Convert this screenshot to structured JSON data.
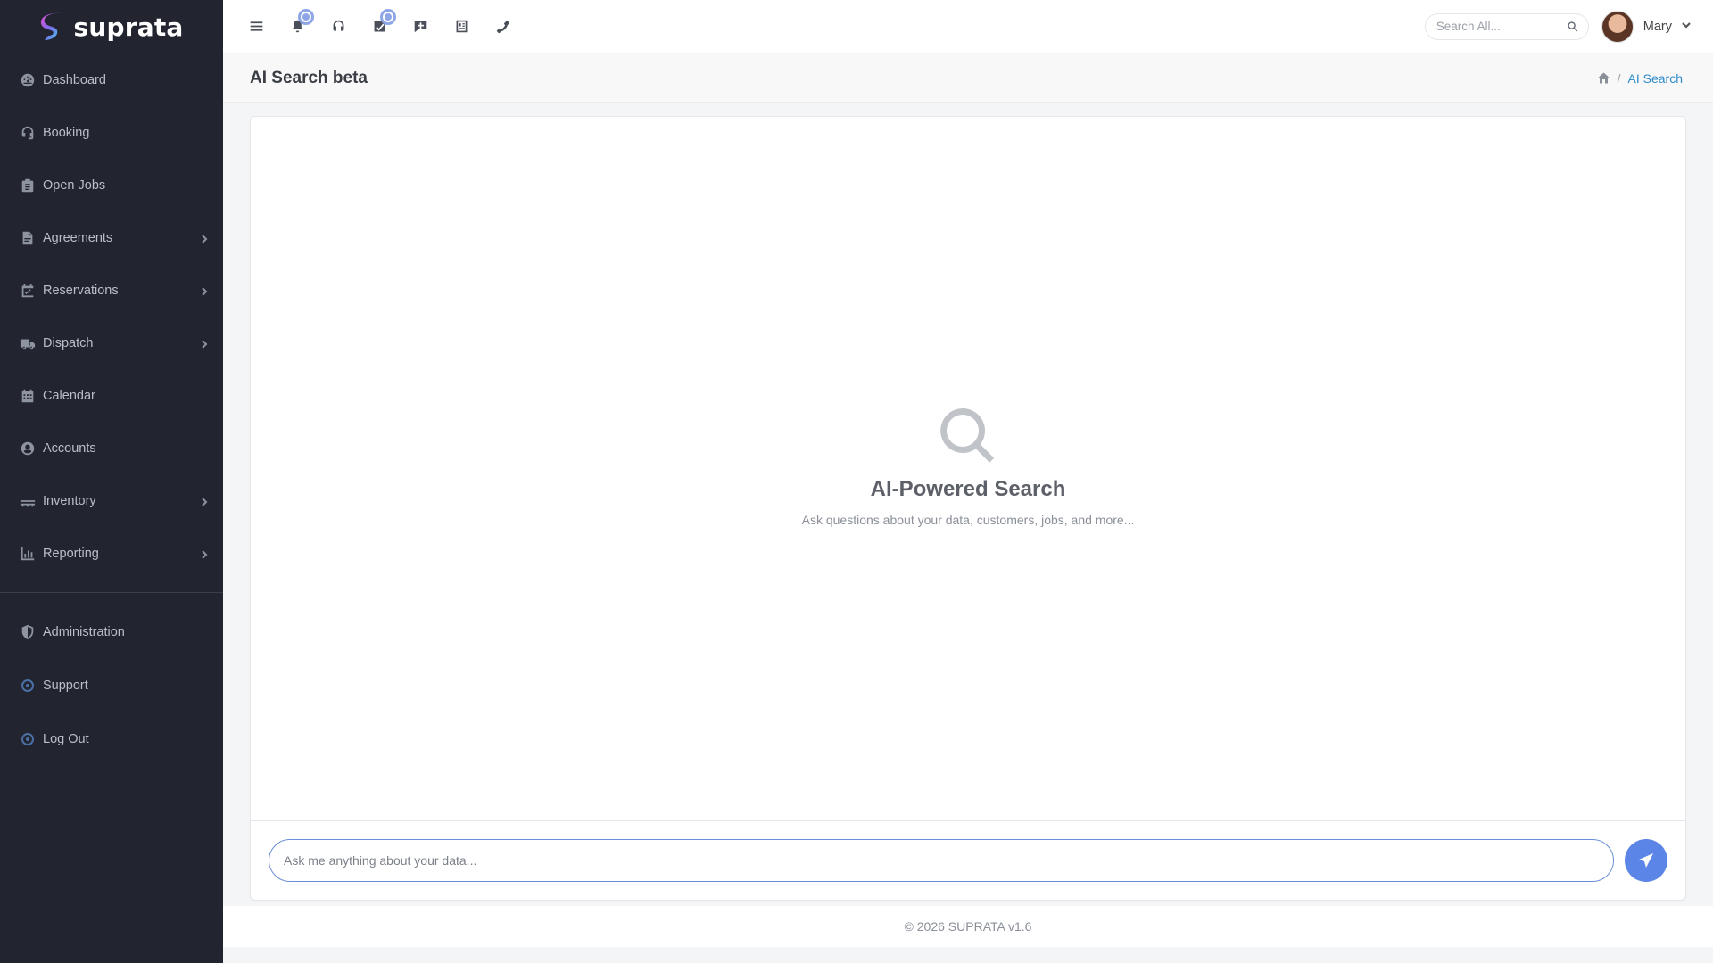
{
  "brand": {
    "name": "suprata"
  },
  "sidebar": {
    "items": [
      {
        "label": "Dashboard",
        "icon": "dashboard-icon",
        "has_children": false
      },
      {
        "label": "Booking",
        "icon": "headset-icon",
        "has_children": false
      },
      {
        "label": "Open Jobs",
        "icon": "clipboard-icon",
        "has_children": false
      },
      {
        "label": "Agreements",
        "icon": "document-icon",
        "has_children": true
      },
      {
        "label": "Reservations",
        "icon": "calendar-check-icon",
        "has_children": true
      },
      {
        "label": "Dispatch",
        "icon": "truck-icon",
        "has_children": true
      },
      {
        "label": "Calendar",
        "icon": "calendar-icon",
        "has_children": false
      },
      {
        "label": "Accounts",
        "icon": "user-circle-icon",
        "has_children": false
      },
      {
        "label": "Inventory",
        "icon": "pallet-icon",
        "has_children": true
      },
      {
        "label": "Reporting",
        "icon": "chart-icon",
        "has_children": true
      }
    ],
    "bottom_items": [
      {
        "label": "Administration",
        "icon": "shield-icon"
      },
      {
        "label": "Support",
        "icon": "ring-dot-icon"
      },
      {
        "label": "Log Out",
        "icon": "ring-dot-icon"
      }
    ]
  },
  "topbar": {
    "icons": [
      "menu-icon",
      "bell-icon",
      "headset-icon",
      "task-icon",
      "message-plus-icon",
      "report-icon",
      "phone-icon"
    ],
    "search_placeholder": "Search All...",
    "user_name": "Mary"
  },
  "page": {
    "title": "AI Search beta",
    "breadcrumb_current": "AI Search",
    "breadcrumb_sep": "/"
  },
  "empty_state": {
    "title": "AI-Powered Search",
    "subtitle": "Ask questions about your data, customers, jobs, and more..."
  },
  "chat": {
    "placeholder": "Ask me anything about your data..."
  },
  "footer": {
    "text": "© 2026 SUPRATA v1.6"
  },
  "colors": {
    "sidebar_bg": "#22252f",
    "accent": "#5b85e6",
    "link": "#2f8bc9"
  }
}
